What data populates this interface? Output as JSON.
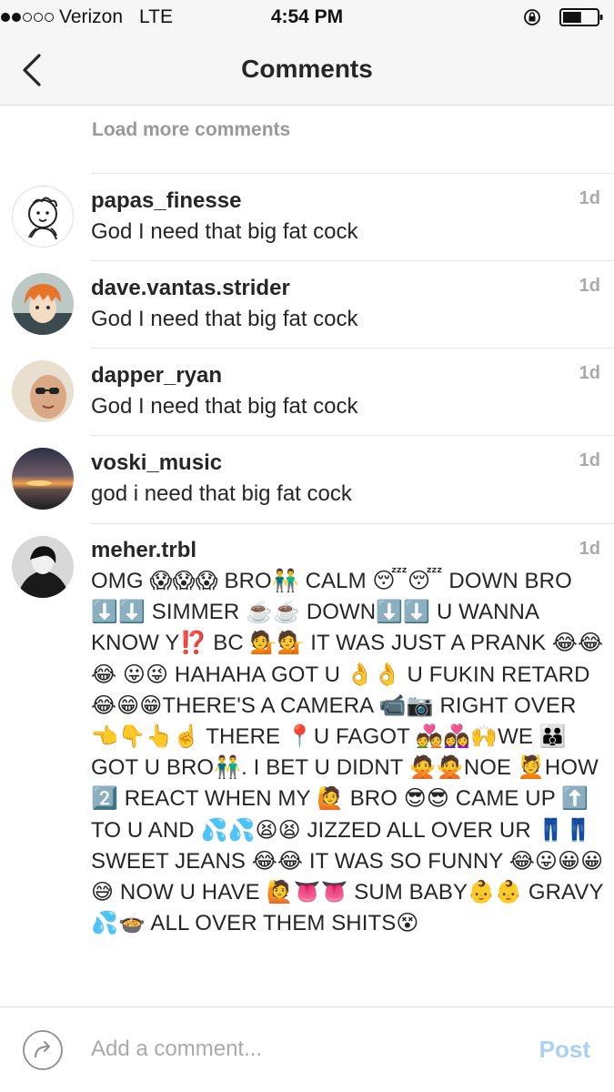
{
  "status_bar": {
    "carrier": "Verizon",
    "network": "LTE",
    "time": "4:54 PM",
    "signal_bars_filled": 2,
    "signal_bars_total": 5,
    "battery_level": 0.55
  },
  "header": {
    "title": "Comments",
    "back_icon": "chevron-left-icon"
  },
  "load_more_label": "Load more comments",
  "comments": [
    {
      "username": "papas_finesse",
      "text": "God I need that big fat cock",
      "age": "1d"
    },
    {
      "username": "dave.vantas.strider",
      "text": "God I need that big fat cock",
      "age": "1d"
    },
    {
      "username": "dapper_ryan",
      "text": "God I need that big fat cock",
      "age": "1d"
    },
    {
      "username": "voski_music",
      "text": "god i need that big fat cock",
      "age": "1d"
    },
    {
      "username": "meher.trbl",
      "text": "OMG 😱😱😱 BRO👬 CALM 😴😴 DOWN BRO ⬇️⬇️ SIMMER ☕️☕️ DOWN⬇️⬇️ U WANNA KNOW Y⁉️ BC 💁💁 IT WAS JUST A PRANK 😂😂😂 😛😜 HAHAHA GOT U 👌👌 U FUKIN RETARD 😂😁😁THERE'S A CAMERA 📹📷 RIGHT OVER 👈👇👆☝️ THERE 📍U FAGOT 💑👩‍❤️‍👩🙌WE 👪 GOT U BRO👬. I BET U DIDNT 🙅🙅NOE 💆HOW 2️⃣ REACT WHEN MY 🙋 BRO 😎😎 CAME UP ⬆️ TO U AND 💦💦😫😫 JIZZED ALL OVER UR 👖👖 SWEET JEANS 😂😂 IT WAS SO FUNNY 😂😛😀😀😅 NOW U HAVE 🙋👅👅 SUM BABY👶👶 GRAVY 💦🍲 ALL OVER THEM SHITS😵",
      "age": "1d"
    }
  ],
  "composer": {
    "placeholder": "Add a comment...",
    "post_label": "Post",
    "share_icon": "share-arrow-icon"
  },
  "colors": {
    "post_inactive": "#a8d1f5",
    "muted_text": "#aaaaaa",
    "primary_text": "#262626",
    "bar_background": "#f6f6f6"
  }
}
